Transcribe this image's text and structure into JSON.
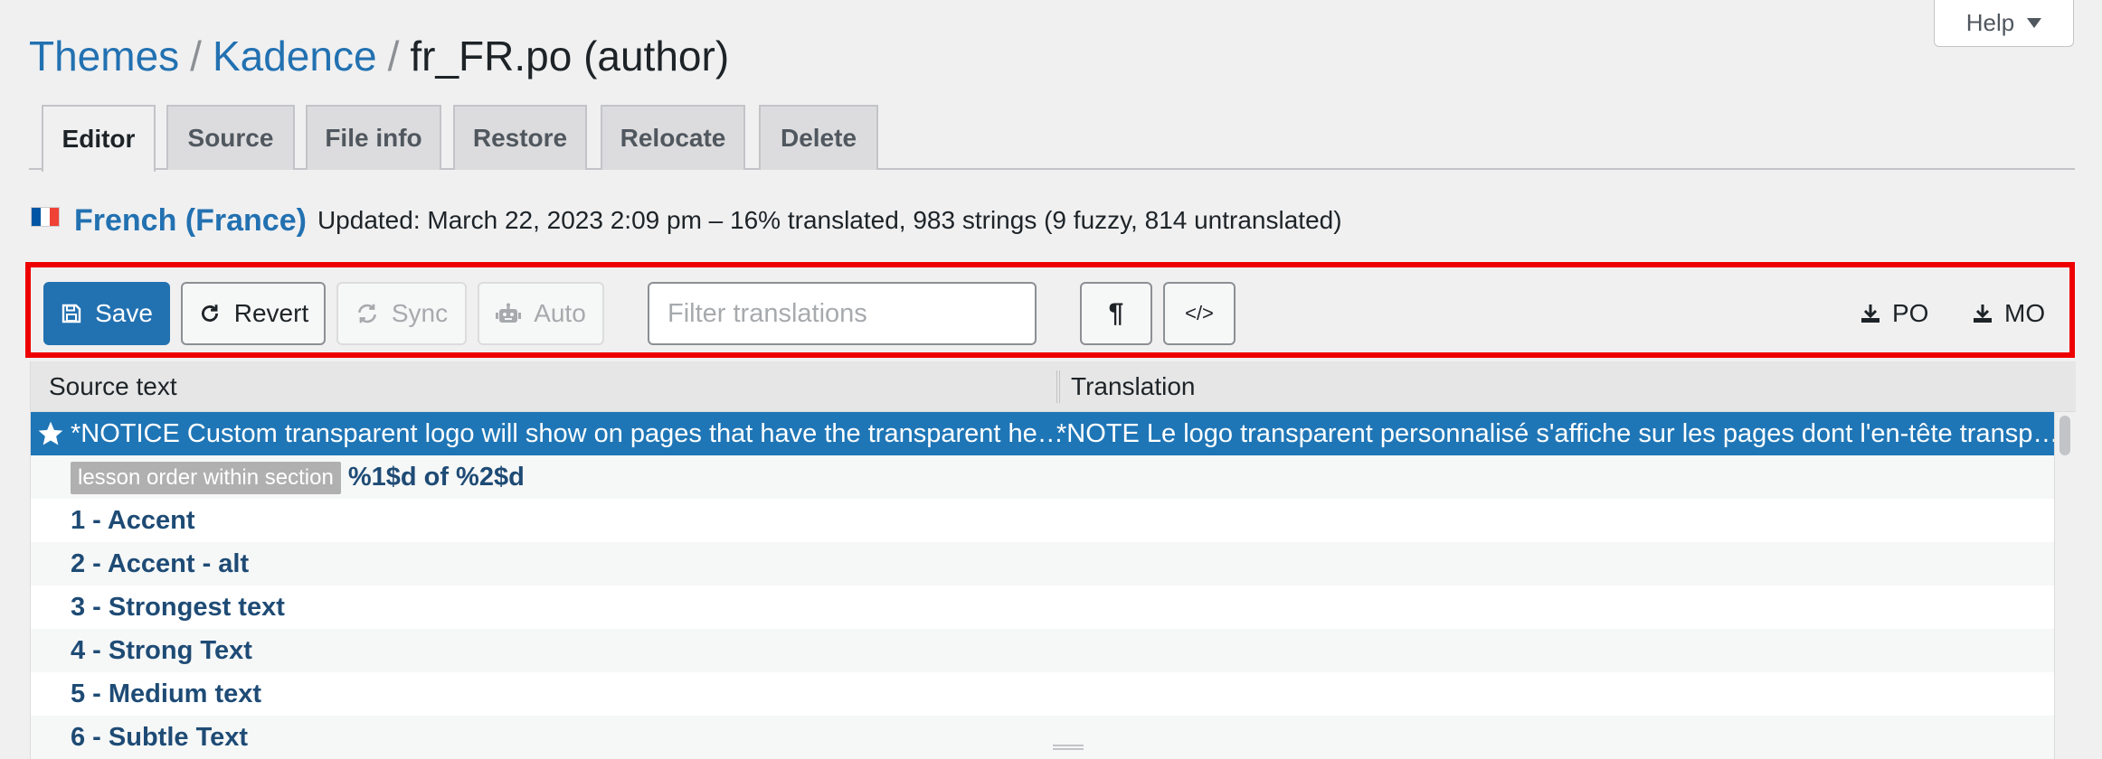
{
  "help": {
    "label": "Help"
  },
  "breadcrumb": {
    "items": [
      "Themes",
      "Kadence"
    ],
    "current": "fr_FR.po (author)",
    "separator": "/"
  },
  "tabs": [
    {
      "label": "Editor",
      "active": true
    },
    {
      "label": "Source"
    },
    {
      "label": "File info"
    },
    {
      "label": "Restore"
    },
    {
      "label": "Relocate"
    },
    {
      "label": "Delete"
    }
  ],
  "locale": {
    "name": "French (France)",
    "status": "Updated: March 22, 2023 2:09 pm – 16% translated, 983 strings (9 fuzzy, 814 untranslated)"
  },
  "toolbar": {
    "save": "Save",
    "revert": "Revert",
    "sync": "Sync",
    "auto": "Auto",
    "filter_placeholder": "Filter translations",
    "invisibles_glyph": "¶",
    "code_glyph": "</>",
    "download_po": "PO",
    "download_mo": "MO"
  },
  "table": {
    "headers": {
      "source": "Source text",
      "translation": "Translation"
    },
    "rows": [
      {
        "source": "*NOTICE Custom transparent logo will show on pages that have the transparent header enabled",
        "translation": "*NOTE Le logo transparent personnalisé s'affiche sur les pages dont l'en-tête transparent est activé"
      },
      {
        "context": "lesson order within section",
        "source": "%1$d of %2$d",
        "translation": ""
      },
      {
        "source": "1 - Accent",
        "translation": ""
      },
      {
        "source": "2 - Accent - alt",
        "translation": ""
      },
      {
        "source": "3 - Strongest text",
        "translation": ""
      },
      {
        "source": "4 - Strong Text",
        "translation": ""
      },
      {
        "source": "5 - Medium text",
        "translation": ""
      },
      {
        "source": "6 - Subtle Text",
        "translation": ""
      }
    ]
  },
  "colors": {
    "accent": "#2271b1",
    "selected_row": "#1f76b6",
    "highlight_border": "#ee0000",
    "flag_blue": "#0055a4",
    "flag_white": "#ffffff",
    "flag_red": "#ef4135"
  }
}
